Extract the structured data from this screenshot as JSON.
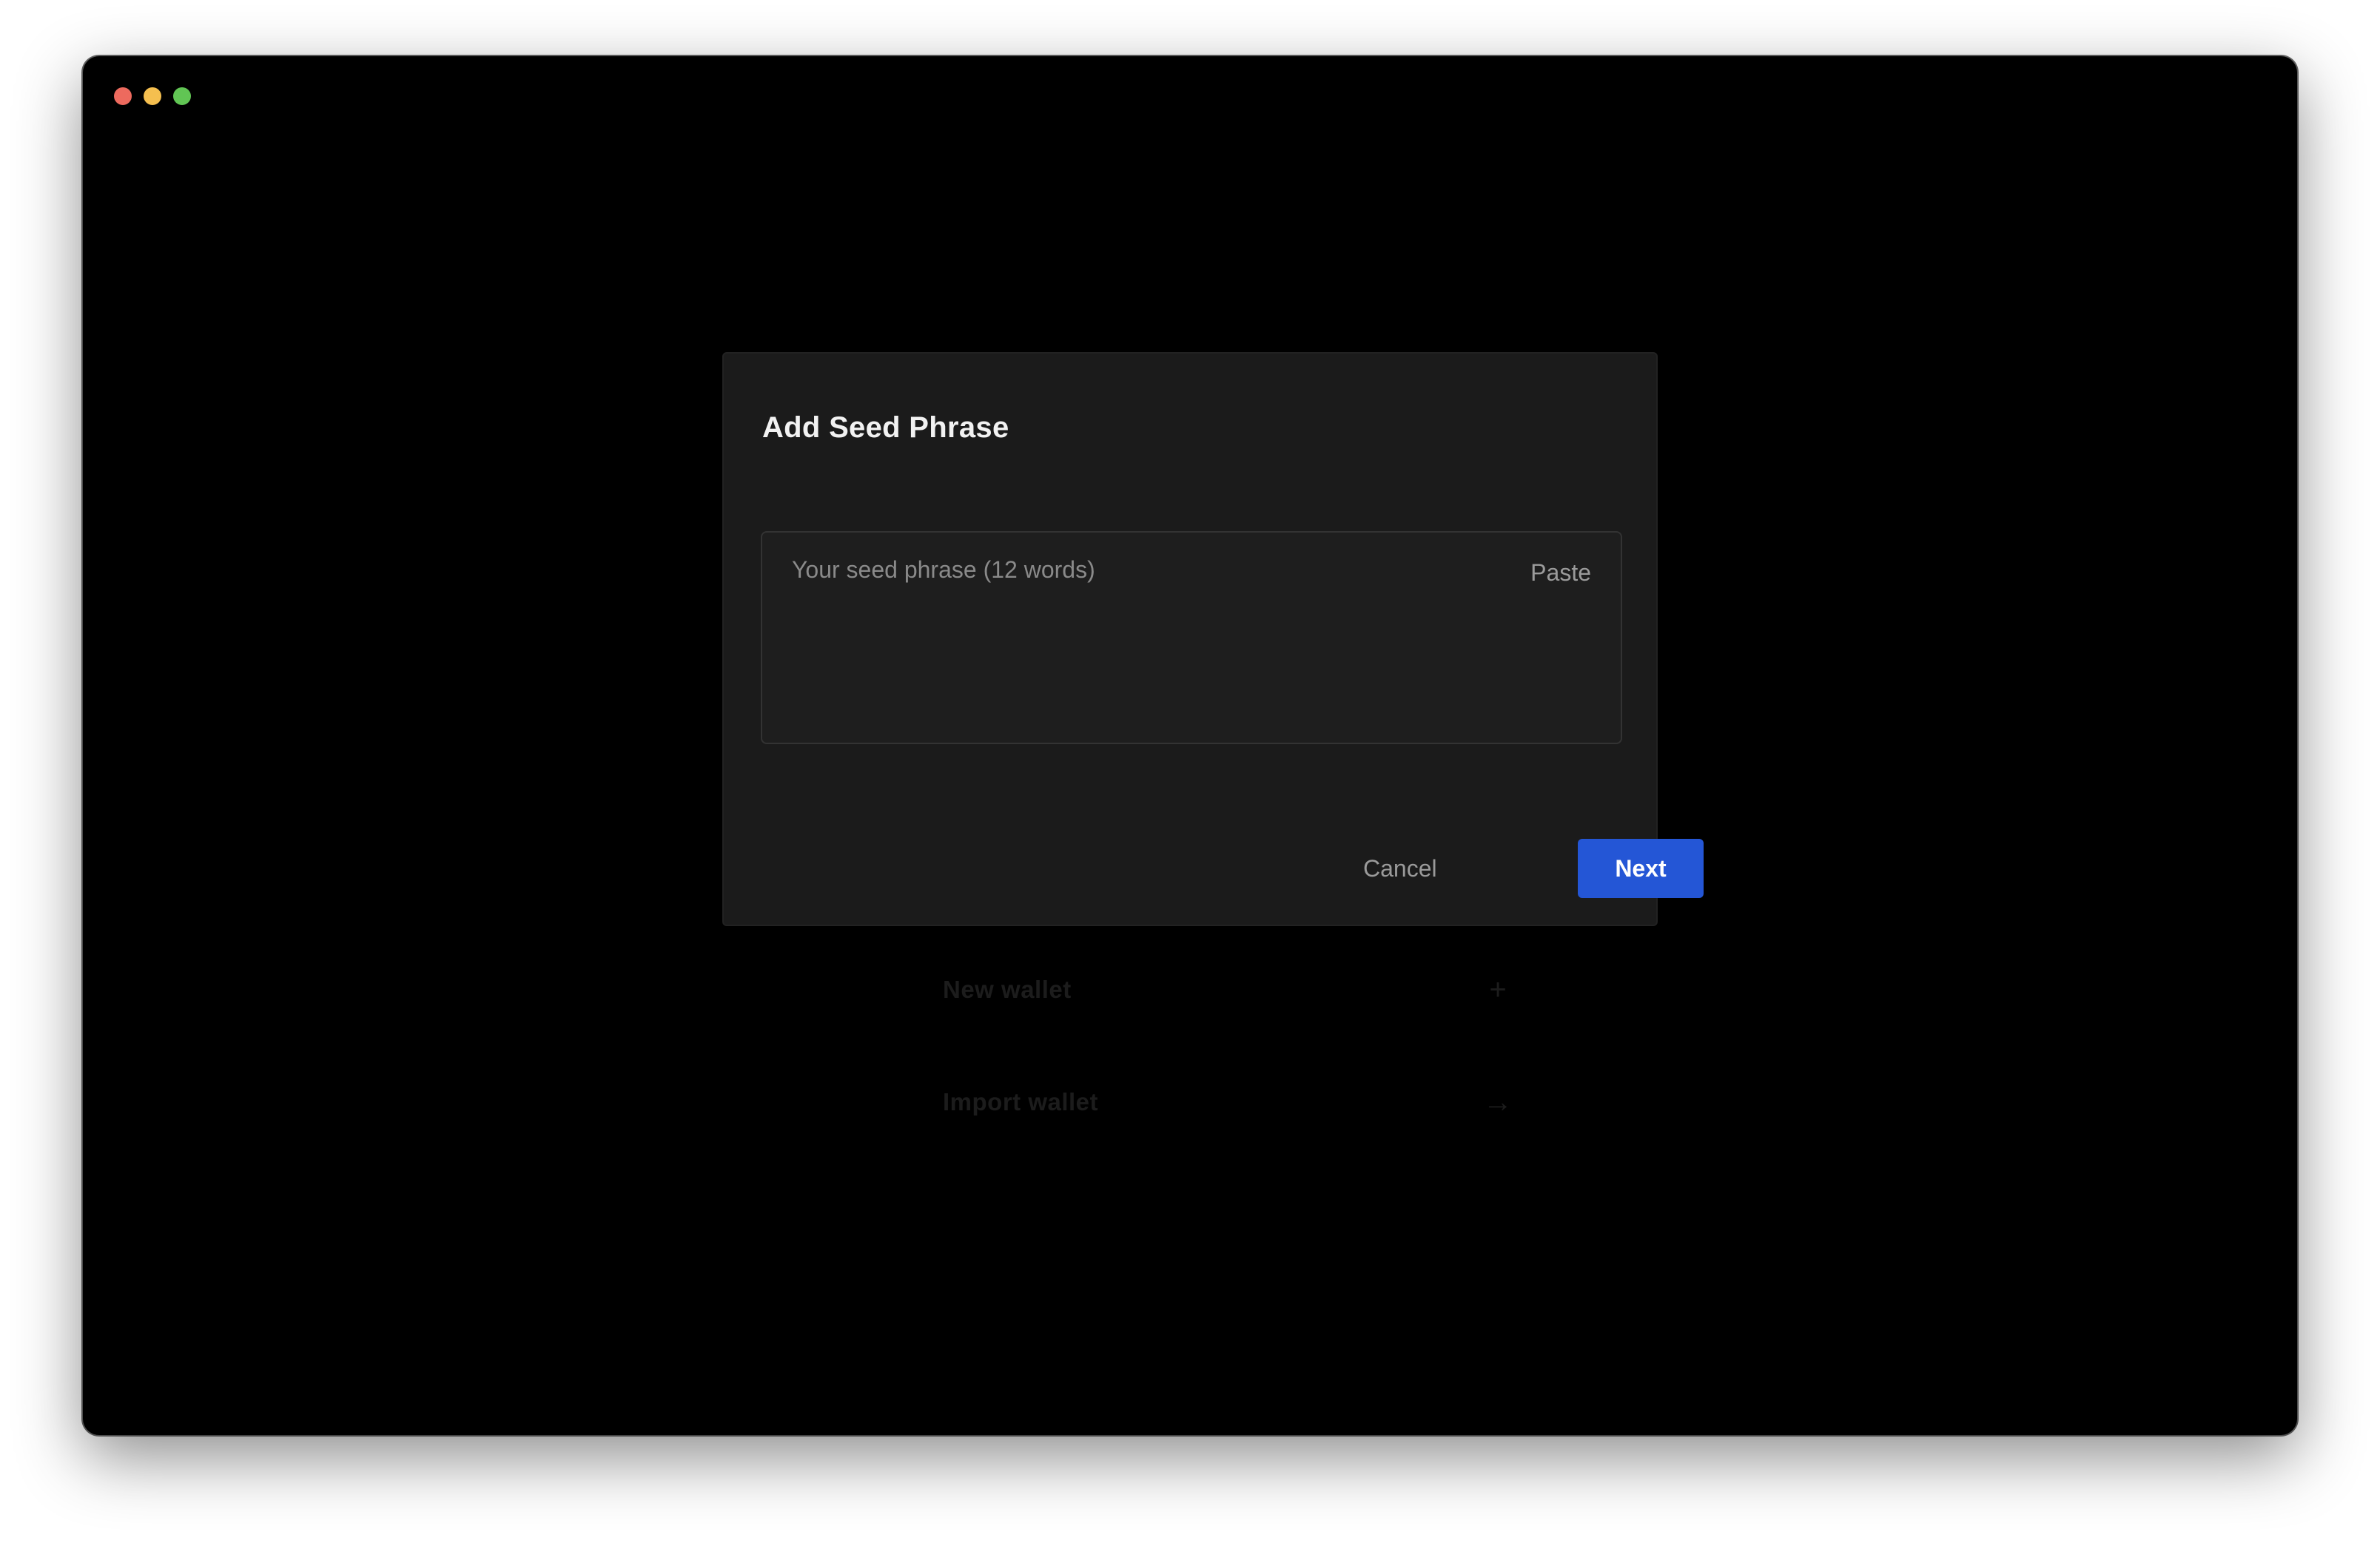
{
  "window": {
    "controls": [
      "close",
      "minimize",
      "zoom"
    ]
  },
  "background_menu": {
    "items": [
      {
        "label": "New wallet",
        "icon": "plus-icon"
      },
      {
        "label": "Import wallet",
        "icon": "arrow-right-icon"
      }
    ]
  },
  "dialog": {
    "title": "Add Seed Phrase",
    "seed_input": {
      "value": "",
      "placeholder": "Your seed phrase (12 words)"
    },
    "paste_label": "Paste",
    "cancel_label": "Cancel",
    "next_label": "Next"
  },
  "colors": {
    "window_bg": "#000000",
    "dialog_bg": "#1b1b1b",
    "accent": "#2456d6",
    "traffic_close": "#ed6a5e",
    "traffic_minimize": "#f5bf4f",
    "traffic_zoom": "#61c554"
  }
}
